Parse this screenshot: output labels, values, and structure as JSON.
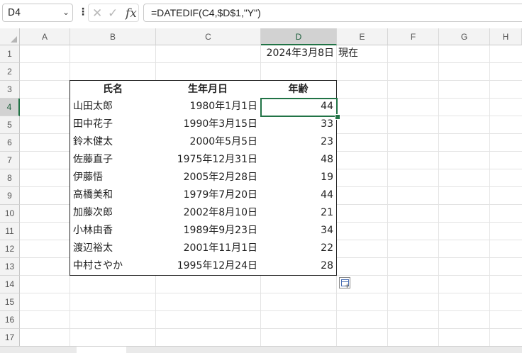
{
  "formula_bar": {
    "name_box": "D4",
    "name_box_arrow": "⌄",
    "more_icon": "⋮",
    "cancel_icon": "✕",
    "enter_icon": "✓",
    "fx_label": "fx",
    "formula": "=DATEDIF(C4,$D$1,\"Y\")"
  },
  "columns": [
    "A",
    "B",
    "C",
    "D",
    "E",
    "F",
    "G",
    "H"
  ],
  "rows": [
    "1",
    "2",
    "3",
    "4",
    "5",
    "6",
    "7",
    "8",
    "9",
    "10",
    "11",
    "12",
    "13",
    "14",
    "15",
    "16",
    "17"
  ],
  "selected_cell": "D4",
  "sheet": {
    "d1": "2024年3月8日",
    "e1": "現在",
    "headers": {
      "name": "氏名",
      "birthdate": "生年月日",
      "age": "年齢"
    },
    "records": [
      {
        "name": "山田太郎",
        "birthdate": "1980年1月1日",
        "age": "44"
      },
      {
        "name": "田中花子",
        "birthdate": "1990年3月15日",
        "age": "33"
      },
      {
        "name": "鈴木健太",
        "birthdate": "2000年5月5日",
        "age": "23"
      },
      {
        "name": "佐藤直子",
        "birthdate": "1975年12月31日",
        "age": "48"
      },
      {
        "name": "伊藤悟",
        "birthdate": "2005年2月28日",
        "age": "19"
      },
      {
        "name": "高橋美和",
        "birthdate": "1979年7月20日",
        "age": "44"
      },
      {
        "name": "加藤次郎",
        "birthdate": "2002年8月10日",
        "age": "21"
      },
      {
        "name": "小林由香",
        "birthdate": "1989年9月23日",
        "age": "34"
      },
      {
        "name": "渡辺裕太",
        "birthdate": "2001年11月1日",
        "age": "22"
      },
      {
        "name": "中村さやか",
        "birthdate": "1995年12月24日",
        "age": "28"
      }
    ]
  },
  "colors": {
    "accent": "#217346",
    "header_bg": "#f3f3f3",
    "selected_header_bg": "#d2d2d2"
  },
  "icons": {
    "quick_analysis": "quick-analysis-icon"
  }
}
